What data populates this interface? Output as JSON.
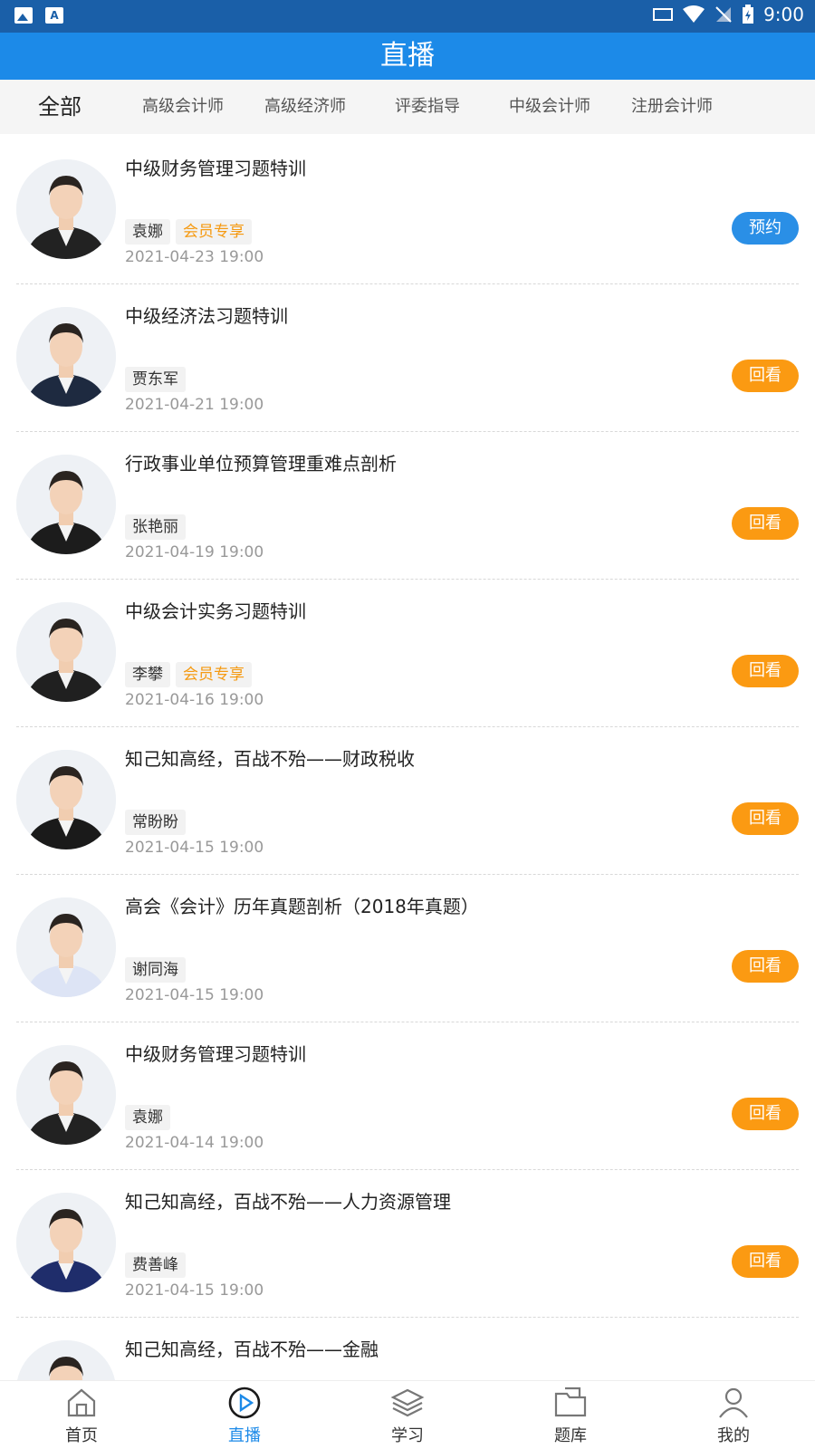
{
  "status_bar": {
    "time": "9:00"
  },
  "header": {
    "title": "直播"
  },
  "tabs": [
    {
      "label": "全部",
      "active": true
    },
    {
      "label": "高级会计师"
    },
    {
      "label": "高级经济师"
    },
    {
      "label": "评委指导"
    },
    {
      "label": "中级会计师"
    },
    {
      "label": "注册会计师"
    }
  ],
  "items": [
    {
      "title": "中级财务管理习题特训",
      "teacher": "袁娜",
      "vip": "会员专享",
      "date": "2021-04-23 19:00",
      "button": "预约",
      "button_type": "reserve",
      "suit": "#222222"
    },
    {
      "title": "中级经济法习题特训",
      "teacher": "贾东军",
      "vip": "",
      "date": "2021-04-21 19:00",
      "button": "回看",
      "button_type": "replay",
      "suit": "#1e2a40"
    },
    {
      "title": "行政事业单位预算管理重难点剖析",
      "teacher": "张艳丽",
      "vip": "",
      "date": "2021-04-19 19:00",
      "button": "回看",
      "button_type": "replay",
      "suit": "#1c1c1c"
    },
    {
      "title": "中级会计实务习题特训",
      "teacher": "李攀",
      "vip": "会员专享",
      "date": "2021-04-16 19:00",
      "button": "回看",
      "button_type": "replay",
      "suit": "#202020"
    },
    {
      "title": "知己知高经，百战不殆——财政税收",
      "teacher": "常盼盼",
      "vip": "",
      "date": "2021-04-15 19:00",
      "button": "回看",
      "button_type": "replay",
      "suit": "#1a1a1a"
    },
    {
      "title": "高会《会计》历年真题剖析（2018年真题）",
      "teacher": "谢同海",
      "vip": "",
      "date": "2021-04-15 19:00",
      "button": "回看",
      "button_type": "replay",
      "suit": "#dde4f5"
    },
    {
      "title": "中级财务管理习题特训",
      "teacher": "袁娜",
      "vip": "",
      "date": "2021-04-14 19:00",
      "button": "回看",
      "button_type": "replay",
      "suit": "#222222"
    },
    {
      "title": "知己知高经，百战不殆——人力资源管理",
      "teacher": "费善峰",
      "vip": "",
      "date": "2021-04-15 19:00",
      "button": "回看",
      "button_type": "replay",
      "suit": "#1f2d6b"
    },
    {
      "title": "知己知高经，百战不殆——金融",
      "teacher": "",
      "vip": "",
      "date": "",
      "button": "",
      "button_type": "replay",
      "suit": "#1a1a1a"
    }
  ],
  "bottom_nav": [
    {
      "label": "首页",
      "icon": "home-icon"
    },
    {
      "label": "直播",
      "icon": "live-play-icon",
      "active": true
    },
    {
      "label": "学习",
      "icon": "layers-icon"
    },
    {
      "label": "题库",
      "icon": "folder-icon"
    },
    {
      "label": "我的",
      "icon": "user-icon"
    }
  ],
  "colors": {
    "primary": "#1c8ae8",
    "status_bar": "#1a5fa8",
    "replay": "#fb9a12",
    "reserve": "#2a8fe6",
    "vip_text": "#f59a12"
  }
}
